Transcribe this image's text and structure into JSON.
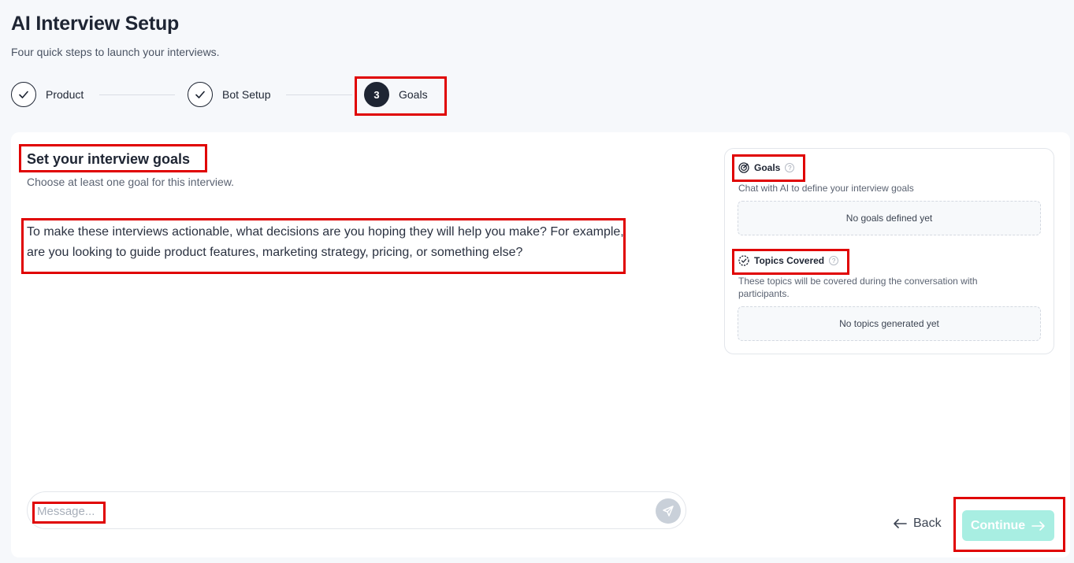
{
  "header": {
    "title": "AI Interview Setup",
    "subtitle": "Four quick steps to launch your interviews."
  },
  "stepper": {
    "steps": [
      {
        "label": "Product",
        "state": "done"
      },
      {
        "label": "Bot Setup",
        "state": "done"
      },
      {
        "label": "Goals",
        "state": "active",
        "number": "3"
      }
    ]
  },
  "main": {
    "heading": "Set your interview goals",
    "subheading": "Choose at least one goal for this interview.",
    "bot_message": "To make these interviews actionable, what decisions are you hoping they will help you make? For example, are you looking to guide product features, marketing strategy, pricing, or something else?",
    "input_placeholder": "Message..."
  },
  "side_panel": {
    "goals": {
      "title": "Goals",
      "description": "Chat with AI to define your interview goals",
      "empty": "No goals defined yet"
    },
    "topics": {
      "title": "Topics Covered",
      "description": "These topics will be covered during the conversation with participants.",
      "empty": "No topics generated yet"
    }
  },
  "footer": {
    "back_label": "Back",
    "continue_label": "Continue"
  },
  "colors": {
    "accent_disabled": "#a8eee2",
    "highlight": "#e00000",
    "dark": "#1e2533"
  }
}
